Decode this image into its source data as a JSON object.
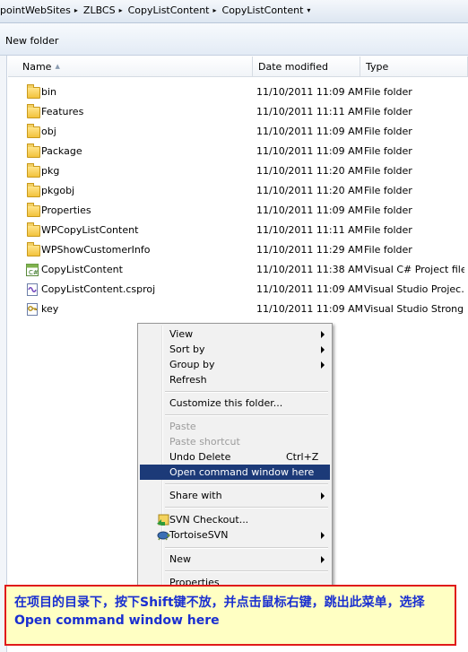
{
  "address": {
    "crumbs": [
      "pointWebSites",
      "ZLBCS",
      "CopyListContent",
      "CopyListContent"
    ]
  },
  "toolbar": {
    "new_folder": "New folder"
  },
  "columns": {
    "name": "Name",
    "date": "Date modified",
    "type": "Type"
  },
  "files": [
    {
      "icon": "folder-icon",
      "name": "bin",
      "date": "11/10/2011 11:09 AM",
      "type": "File folder"
    },
    {
      "icon": "folder-icon",
      "name": "Features",
      "date": "11/10/2011 11:11 AM",
      "type": "File folder"
    },
    {
      "icon": "folder-icon",
      "name": "obj",
      "date": "11/10/2011 11:09 AM",
      "type": "File folder"
    },
    {
      "icon": "folder-icon",
      "name": "Package",
      "date": "11/10/2011 11:09 AM",
      "type": "File folder"
    },
    {
      "icon": "folder-icon",
      "name": "pkg",
      "date": "11/10/2011 11:20 AM",
      "type": "File folder"
    },
    {
      "icon": "folder-icon",
      "name": "pkgobj",
      "date": "11/10/2011 11:20 AM",
      "type": "File folder"
    },
    {
      "icon": "folder-icon",
      "name": "Properties",
      "date": "11/10/2011 11:09 AM",
      "type": "File folder"
    },
    {
      "icon": "folder-icon",
      "name": "WPCopyListContent",
      "date": "11/10/2011 11:11 AM",
      "type": "File folder"
    },
    {
      "icon": "folder-icon",
      "name": "WPShowCustomerInfo",
      "date": "11/10/2011 11:29 AM",
      "type": "File folder"
    },
    {
      "icon": "csharp-project-icon",
      "name": "CopyListContent",
      "date": "11/10/2011 11:38 AM",
      "type": "Visual C# Project file"
    },
    {
      "icon": "vs-project-icon",
      "name": "CopyListContent.csproj",
      "date": "11/10/2011 11:09 AM",
      "type": "Visual Studio Projec…"
    },
    {
      "icon": "key-icon",
      "name": "key",
      "date": "11/10/2011 11:09 AM",
      "type": "Visual Studio Strong…"
    }
  ],
  "menu": {
    "view": "View",
    "sort_by": "Sort by",
    "group_by": "Group by",
    "refresh": "Refresh",
    "customize": "Customize this folder...",
    "paste": "Paste",
    "paste_shortcut": "Paste shortcut",
    "undo_delete": "Undo Delete",
    "undo_shortcut": "Ctrl+Z",
    "open_cmd": "Open command window here",
    "share_with": "Share with",
    "svn_checkout": "SVN Checkout...",
    "tortoise": "TortoiseSVN",
    "new": "New",
    "properties": "Properties"
  },
  "annotation": {
    "text": "在项目的目录下，按下Shift键不放，并点击鼠标右键，跳出此菜单，选择Open command window here"
  },
  "colors": {
    "menu_highlight": "#1c3a78",
    "annotation_border": "#e01a1a",
    "annotation_text": "#1a2fd0",
    "annotation_bg": "#ffffc3"
  }
}
